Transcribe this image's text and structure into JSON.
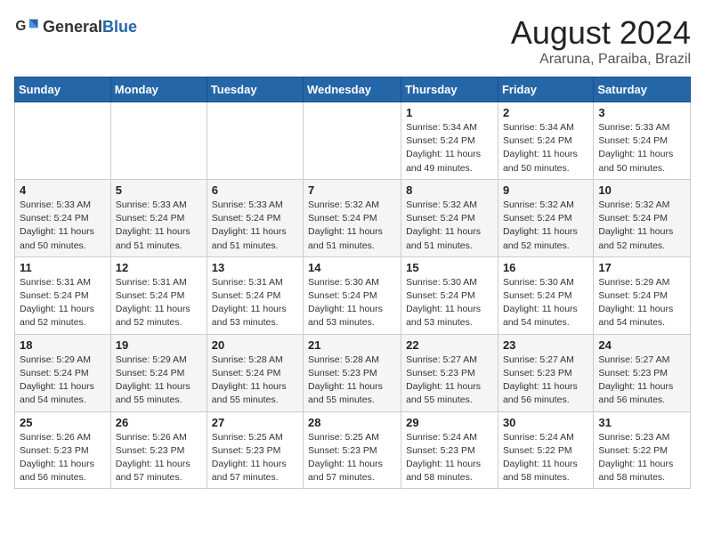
{
  "header": {
    "logo_general": "General",
    "logo_blue": "Blue",
    "title": "August 2024",
    "location": "Araruna, Paraiba, Brazil"
  },
  "days_of_week": [
    "Sunday",
    "Monday",
    "Tuesday",
    "Wednesday",
    "Thursday",
    "Friday",
    "Saturday"
  ],
  "weeks": [
    [
      {
        "day": "",
        "info": ""
      },
      {
        "day": "",
        "info": ""
      },
      {
        "day": "",
        "info": ""
      },
      {
        "day": "",
        "info": ""
      },
      {
        "day": "1",
        "info": "Sunrise: 5:34 AM\nSunset: 5:24 PM\nDaylight: 11 hours and 49 minutes."
      },
      {
        "day": "2",
        "info": "Sunrise: 5:34 AM\nSunset: 5:24 PM\nDaylight: 11 hours and 50 minutes."
      },
      {
        "day": "3",
        "info": "Sunrise: 5:33 AM\nSunset: 5:24 PM\nDaylight: 11 hours and 50 minutes."
      }
    ],
    [
      {
        "day": "4",
        "info": "Sunrise: 5:33 AM\nSunset: 5:24 PM\nDaylight: 11 hours and 50 minutes."
      },
      {
        "day": "5",
        "info": "Sunrise: 5:33 AM\nSunset: 5:24 PM\nDaylight: 11 hours and 51 minutes."
      },
      {
        "day": "6",
        "info": "Sunrise: 5:33 AM\nSunset: 5:24 PM\nDaylight: 11 hours and 51 minutes."
      },
      {
        "day": "7",
        "info": "Sunrise: 5:32 AM\nSunset: 5:24 PM\nDaylight: 11 hours and 51 minutes."
      },
      {
        "day": "8",
        "info": "Sunrise: 5:32 AM\nSunset: 5:24 PM\nDaylight: 11 hours and 51 minutes."
      },
      {
        "day": "9",
        "info": "Sunrise: 5:32 AM\nSunset: 5:24 PM\nDaylight: 11 hours and 52 minutes."
      },
      {
        "day": "10",
        "info": "Sunrise: 5:32 AM\nSunset: 5:24 PM\nDaylight: 11 hours and 52 minutes."
      }
    ],
    [
      {
        "day": "11",
        "info": "Sunrise: 5:31 AM\nSunset: 5:24 PM\nDaylight: 11 hours and 52 minutes."
      },
      {
        "day": "12",
        "info": "Sunrise: 5:31 AM\nSunset: 5:24 PM\nDaylight: 11 hours and 52 minutes."
      },
      {
        "day": "13",
        "info": "Sunrise: 5:31 AM\nSunset: 5:24 PM\nDaylight: 11 hours and 53 minutes."
      },
      {
        "day": "14",
        "info": "Sunrise: 5:30 AM\nSunset: 5:24 PM\nDaylight: 11 hours and 53 minutes."
      },
      {
        "day": "15",
        "info": "Sunrise: 5:30 AM\nSunset: 5:24 PM\nDaylight: 11 hours and 53 minutes."
      },
      {
        "day": "16",
        "info": "Sunrise: 5:30 AM\nSunset: 5:24 PM\nDaylight: 11 hours and 54 minutes."
      },
      {
        "day": "17",
        "info": "Sunrise: 5:29 AM\nSunset: 5:24 PM\nDaylight: 11 hours and 54 minutes."
      }
    ],
    [
      {
        "day": "18",
        "info": "Sunrise: 5:29 AM\nSunset: 5:24 PM\nDaylight: 11 hours and 54 minutes."
      },
      {
        "day": "19",
        "info": "Sunrise: 5:29 AM\nSunset: 5:24 PM\nDaylight: 11 hours and 55 minutes."
      },
      {
        "day": "20",
        "info": "Sunrise: 5:28 AM\nSunset: 5:24 PM\nDaylight: 11 hours and 55 minutes."
      },
      {
        "day": "21",
        "info": "Sunrise: 5:28 AM\nSunset: 5:23 PM\nDaylight: 11 hours and 55 minutes."
      },
      {
        "day": "22",
        "info": "Sunrise: 5:27 AM\nSunset: 5:23 PM\nDaylight: 11 hours and 55 minutes."
      },
      {
        "day": "23",
        "info": "Sunrise: 5:27 AM\nSunset: 5:23 PM\nDaylight: 11 hours and 56 minutes."
      },
      {
        "day": "24",
        "info": "Sunrise: 5:27 AM\nSunset: 5:23 PM\nDaylight: 11 hours and 56 minutes."
      }
    ],
    [
      {
        "day": "25",
        "info": "Sunrise: 5:26 AM\nSunset: 5:23 PM\nDaylight: 11 hours and 56 minutes."
      },
      {
        "day": "26",
        "info": "Sunrise: 5:26 AM\nSunset: 5:23 PM\nDaylight: 11 hours and 57 minutes."
      },
      {
        "day": "27",
        "info": "Sunrise: 5:25 AM\nSunset: 5:23 PM\nDaylight: 11 hours and 57 minutes."
      },
      {
        "day": "28",
        "info": "Sunrise: 5:25 AM\nSunset: 5:23 PM\nDaylight: 11 hours and 57 minutes."
      },
      {
        "day": "29",
        "info": "Sunrise: 5:24 AM\nSunset: 5:23 PM\nDaylight: 11 hours and 58 minutes."
      },
      {
        "day": "30",
        "info": "Sunrise: 5:24 AM\nSunset: 5:22 PM\nDaylight: 11 hours and 58 minutes."
      },
      {
        "day": "31",
        "info": "Sunrise: 5:23 AM\nSunset: 5:22 PM\nDaylight: 11 hours and 58 minutes."
      }
    ]
  ]
}
